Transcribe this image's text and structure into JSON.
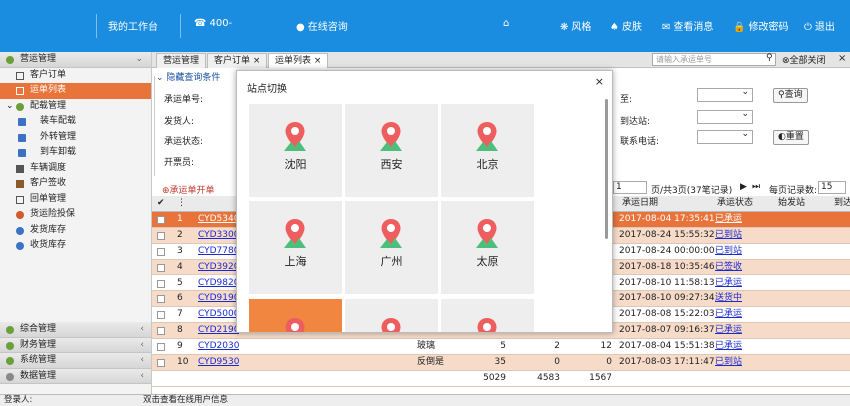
{
  "topbar": {
    "workbench": "我的工作台",
    "phone": "400-",
    "consult": "在线咨询",
    "style": "风格",
    "skin": "皮肤",
    "messages": "查看消息",
    "password": "修改密码",
    "logout": "退出"
  },
  "sidebar": {
    "groups": [
      {
        "label": "营运管理",
        "items": [
          {
            "label": "客户订单"
          },
          {
            "label": "运单列表",
            "active": true
          },
          {
            "label": "配载管理",
            "group": true
          },
          {
            "label": "装车配载",
            "sub": true
          },
          {
            "label": "外转管理",
            "sub": true
          },
          {
            "label": "到车卸载",
            "sub": true
          },
          {
            "label": "车辆调度"
          },
          {
            "label": "客户签收"
          },
          {
            "label": "回单管理"
          },
          {
            "label": "货运险投保"
          },
          {
            "label": "发货库存"
          },
          {
            "label": "收货库存"
          }
        ]
      },
      {
        "label": "综合管理"
      },
      {
        "label": "财务管理"
      },
      {
        "label": "系统管理"
      },
      {
        "label": "数据管理"
      }
    ]
  },
  "tabs": [
    "营运管理",
    "客户订单",
    "运单列表"
  ],
  "search_placeholder": "请输入承运单号",
  "close_all": "全部关闭",
  "filter": {
    "toggle": "隐藏查询条件",
    "labels": [
      "承运单号:",
      "发货人:",
      "承运状态:",
      "开票员:",
      "至:",
      "到达站:",
      "联系电话:"
    ],
    "query_btn": "查询",
    "reset_btn": "重置"
  },
  "toolbar": {
    "new_btn": "承运单开单",
    "page": "1",
    "page_info": "页/共3页(37笔记录)",
    "per_page_label": "每页记录数:",
    "per_page": "15"
  },
  "grid": {
    "headers": [
      "承运日期",
      "承运状态",
      "始发站",
      "到达"
    ],
    "rows": [
      {
        "n": "1",
        "id": "CYD5340",
        "goods": "",
        "a": "",
        "b": "",
        "c": "",
        "date": "2017-08-04 17:35:41",
        "status": "已承运"
      },
      {
        "n": "2",
        "id": "CYD3300",
        "goods": "",
        "a": "",
        "b": "",
        "c": "",
        "date": "2017-08-24 15:55:32",
        "status": "已到站"
      },
      {
        "n": "3",
        "id": "CYD7780",
        "goods": "",
        "a": "",
        "b": "",
        "c": "",
        "date": "2017-08-24 00:00:00",
        "status": "已到站"
      },
      {
        "n": "4",
        "id": "CYD3920",
        "goods": "",
        "a": "",
        "b": "",
        "c": "",
        "date": "2017-08-18 10:35:46",
        "status": "已签收"
      },
      {
        "n": "5",
        "id": "CYD9820",
        "goods": "",
        "a": "",
        "b": "",
        "c": "",
        "date": "2017-08-10 11:58:13",
        "status": "已承运"
      },
      {
        "n": "6",
        "id": "CYD9190",
        "goods": "",
        "a": "",
        "b": "",
        "c": "",
        "date": "2017-08-10 09:27:34",
        "status": "送货中"
      },
      {
        "n": "7",
        "id": "CYD5000",
        "goods": "",
        "a": "",
        "b": "",
        "c": "",
        "date": "2017-08-08 15:22:03",
        "status": "已承运"
      },
      {
        "n": "8",
        "id": "CYD2190",
        "goods": "",
        "a": "",
        "b": "",
        "c": "",
        "date": "2017-08-07 09:16:37",
        "status": "已承运"
      },
      {
        "n": "9",
        "id": "CYD2030",
        "goods": "玻璃",
        "a": "5",
        "b": "2",
        "c": "12",
        "date": "2017-08-04 15:51:38",
        "status": "已承运"
      },
      {
        "n": "10",
        "id": "CYD9530",
        "goods": "反倒是",
        "a": "35",
        "b": "0",
        "c": "0",
        "date": "2017-08-03 17:11:47",
        "status": "已到站"
      }
    ],
    "totals": {
      "a": "5029",
      "b": "4583",
      "c": "1567"
    }
  },
  "footer": {
    "login": "登录人:",
    "hint": "双击查看在线用户信息"
  },
  "modal": {
    "title": "站点切换",
    "close": "×",
    "cities": [
      "沈阳",
      "西安",
      "北京",
      "上海",
      "广州",
      "太原"
    ]
  },
  "colors": {
    "topbar": "#1a8de0",
    "selected_row": "#e8743b",
    "alt_row": "#f6dbc9",
    "pin": "#ee5e5e",
    "mountain": "#4dbf7a"
  }
}
